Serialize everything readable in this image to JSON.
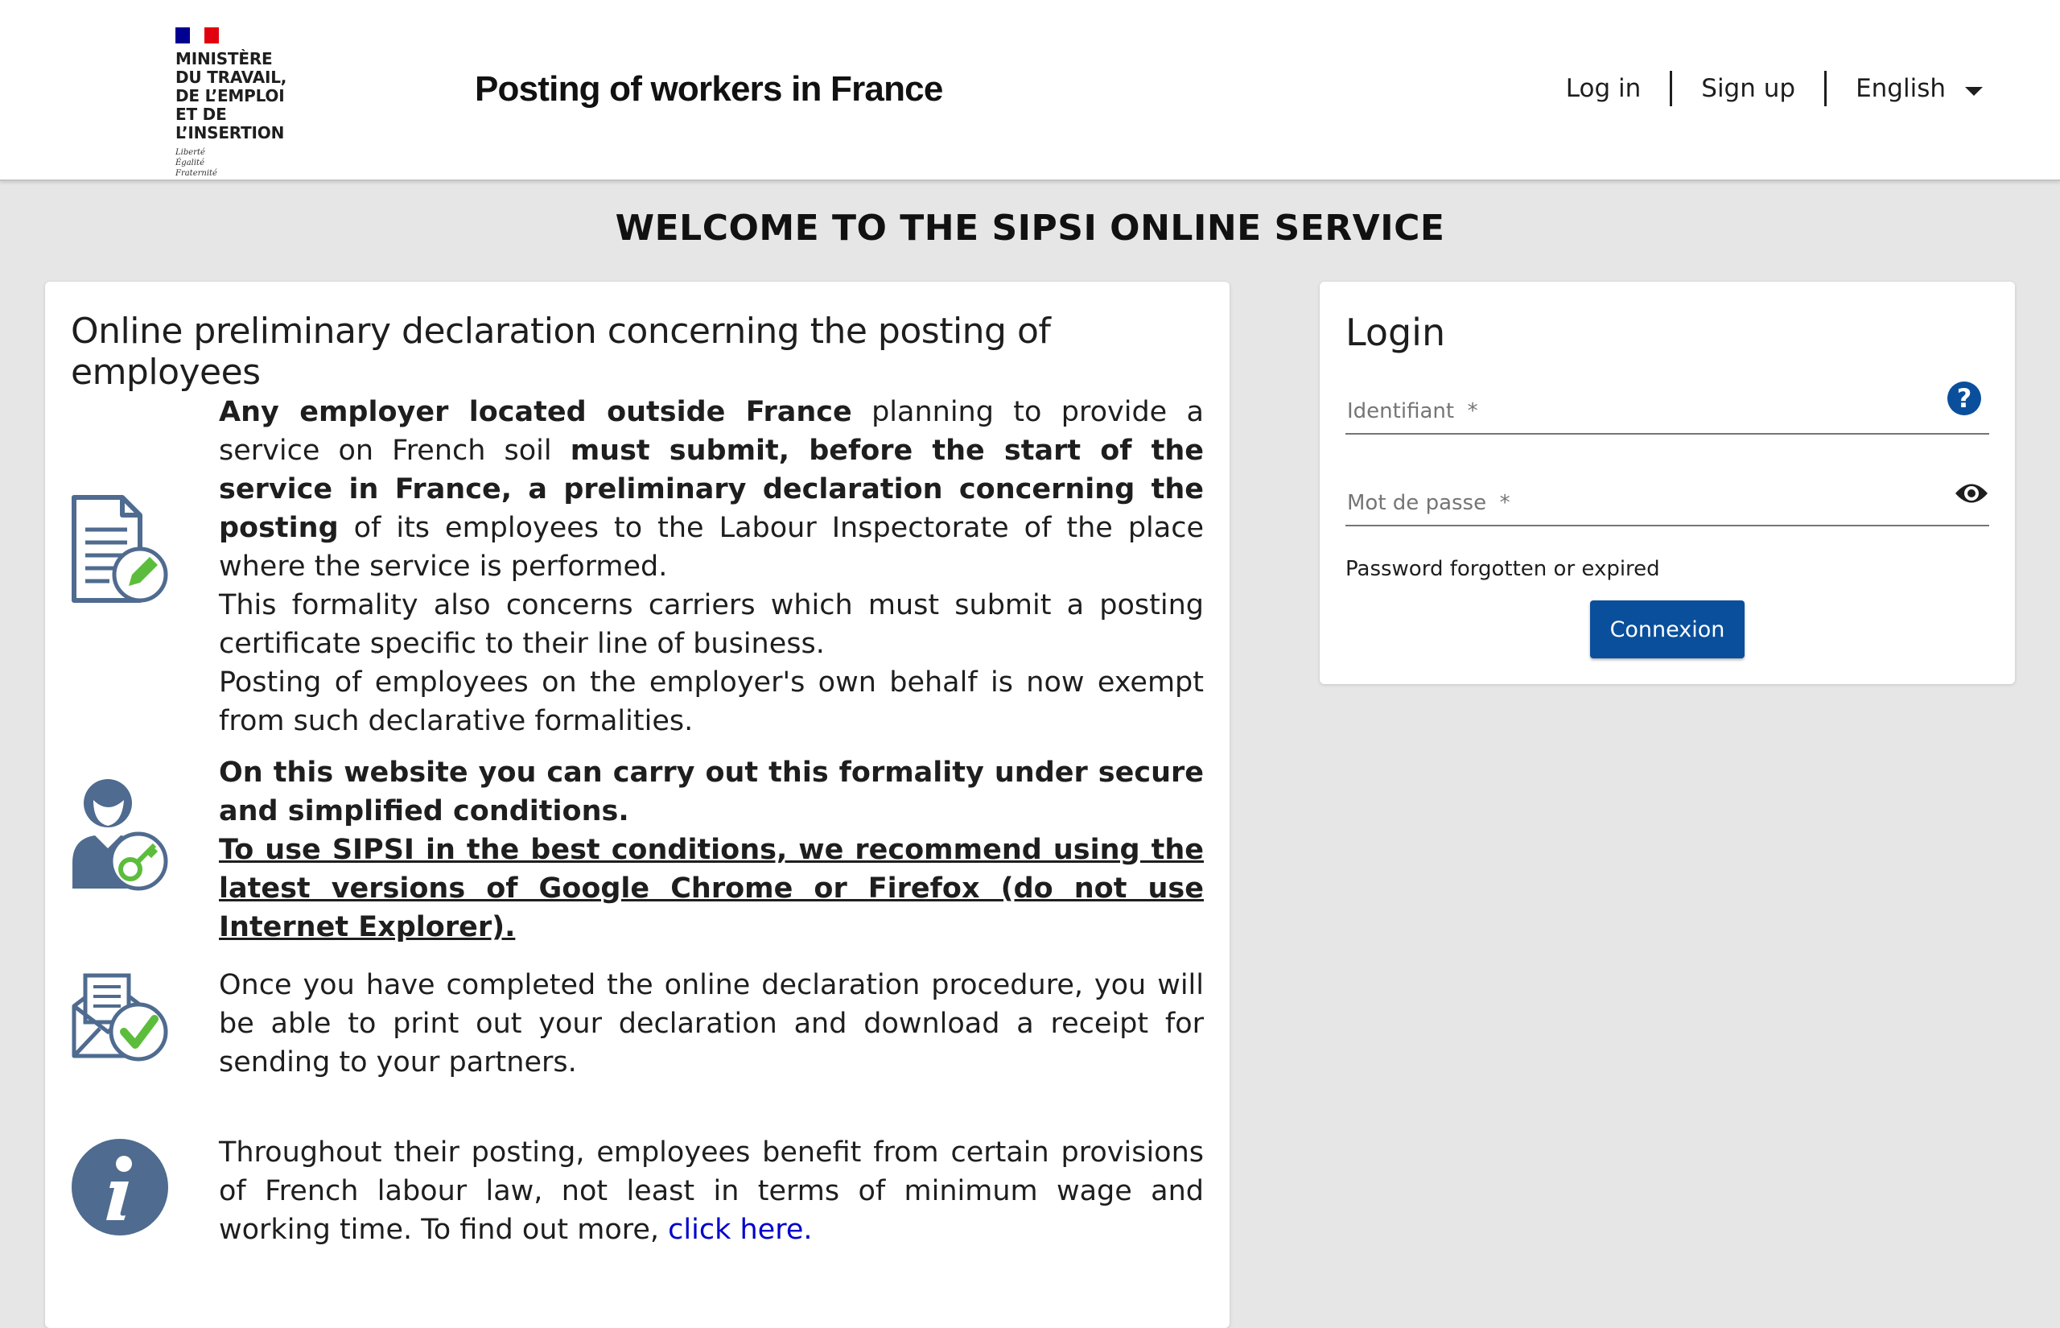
{
  "header": {
    "ministry_lines": "MINISTÈRE\nDU TRAVAIL,\nDE L’EMPLOI\nET DE L’INSERTION",
    "motto": "Liberté\nÉgalité\nFraternité",
    "site_title": "Posting of workers in France",
    "nav": {
      "login": "Log in",
      "signup": "Sign up",
      "language": "English"
    }
  },
  "welcome": "WELCOME TO THE SIPSI ONLINE SERVICE",
  "main": {
    "title": "Online preliminary declaration concerning the posting of employees",
    "section1": {
      "p1_bold1": "Any employer located outside France",
      "p1_text1": " planning to provide a service on French soil ",
      "p1_bold2": "must submit, before the start of the service in France, a preliminary declaration concerning the posting",
      "p1_text2": " of its employees to the Labour Inspectorate of the place where the service is performed.",
      "p2": "This formality also concerns carriers which must submit a posting certificate specific to their line of business.",
      "p3": "Posting of employees on the employer's own behalf is now exempt from such declarative formalities."
    },
    "section2": {
      "bold": "On this website you can carry out this formality under secure and simplified conditions.",
      "underline": "To use SIPSI in the best conditions, we recommend using the latest versions of Google Chrome or Firefox (do not use Internet Explorer)."
    },
    "section3": {
      "text": "Once you have completed the online declaration procedure, you will be able to print out your declaration and download a receipt for sending to your partners."
    },
    "section4": {
      "text": "Throughout their posting, employees benefit from certain provisions of French labour law, not least in terms of minimum wage and working time. To find out more, ",
      "link": "click here."
    }
  },
  "login": {
    "title": "Login",
    "identifiant_placeholder": "Identifiant  *",
    "password_placeholder": "Mot de passe  *",
    "forgot": "Password forgotten or expired",
    "button": "Connexion",
    "help_glyph": "?"
  },
  "colors": {
    "brand_blue": "#0a4f9c",
    "icon_slate": "#4f6b8f",
    "icon_green": "#5cbd3c",
    "link": "#0000cc"
  },
  "icons": [
    "document-edit-icon",
    "user-key-icon",
    "envelope-check-icon",
    "info-icon",
    "help-icon",
    "eye-icon"
  ]
}
